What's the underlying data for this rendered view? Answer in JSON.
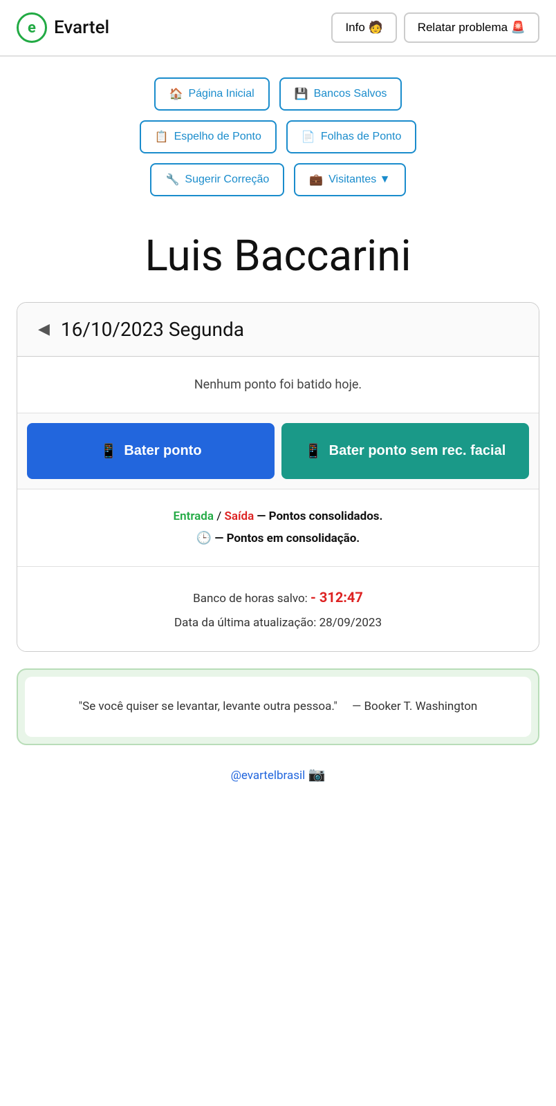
{
  "header": {
    "logo_letter": "e",
    "logo_name": "Evartel",
    "info_button": "Info 🧑",
    "report_button": "Relatar problema 🚨"
  },
  "nav": {
    "row1": [
      {
        "id": "pagina-inicial",
        "icon": "🏠",
        "label": "Página Inicial"
      },
      {
        "id": "bancos-salvos",
        "icon": "💾",
        "label": "Bancos Salvos"
      }
    ],
    "row2": [
      {
        "id": "espelho-ponto",
        "icon": "📋",
        "label": "Espelho de Ponto"
      },
      {
        "id": "folhas-ponto",
        "icon": "📄",
        "label": "Folhas de Ponto"
      }
    ],
    "row3": [
      {
        "id": "sugerir-correcao",
        "icon": "🔧",
        "label": "Sugerir Correção"
      },
      {
        "id": "visitantes",
        "icon": "💼",
        "label": "Visitantes ▼"
      }
    ]
  },
  "main": {
    "user_name": "Luis Baccarini"
  },
  "card": {
    "back_arrow": "◀",
    "date": "16/10/2023 Segunda",
    "no_punch_text": "Nenhum ponto foi batido hoje.",
    "bater_ponto_label": "Bater ponto",
    "bater_ponto_icon": "📱",
    "bater_sem_facial_label": "Bater ponto sem rec. facial",
    "bater_sem_facial_icon": "📱",
    "legend": {
      "entrada": "Entrada",
      "slash": " / ",
      "saida": "Saída",
      "consolidated_text": " — Pontos consolidados.",
      "consolidating_text": " — Pontos em consolidação."
    },
    "banco": {
      "saved_label": "Banco de horas salvo: ",
      "saved_value": "- 312:47",
      "update_label": "Data da última atualização: ",
      "update_date": "28/09/2023"
    }
  },
  "quote": {
    "text": "\"Se você quiser se levantar, levante outra pessoa.\"",
    "author": "— Booker T. Washington"
  },
  "footer": {
    "instagram_handle": "@evartelbrasil",
    "instagram_icon": "📷"
  }
}
